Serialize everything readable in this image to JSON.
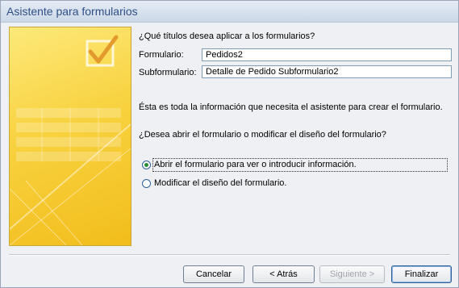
{
  "window": {
    "title": "Asistente para formularios"
  },
  "form": {
    "question": "¿Qué títulos desea aplicar a los formularios?",
    "formulario_label": "Formulario:",
    "formulario_value": "Pedidos2",
    "subformulario_label": "Subformulario:",
    "subformulario_value": "Detalle de Pedido Subformulario2",
    "info_text": "Ésta es toda la información que necesita el asistente para crear el formulario.",
    "open_question": "¿Desea abrir el formulario o modificar el diseño del formulario?",
    "options": [
      {
        "label": "Abrir el formulario para ver o introducir información.",
        "selected": true
      },
      {
        "label": "Modificar el diseño del formulario.",
        "selected": false
      }
    ]
  },
  "buttons": {
    "cancel": "Cancelar",
    "back": "< Atrás",
    "next": "Siguiente >",
    "finish": "Finalizar"
  },
  "colors": {
    "accent": "#2e5f99",
    "art_yellow": "#f8d23f"
  }
}
